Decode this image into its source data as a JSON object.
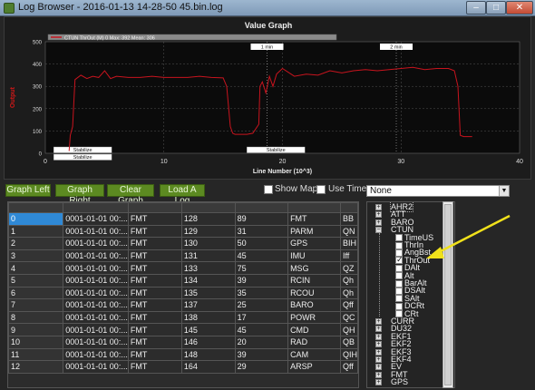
{
  "window": {
    "title": "Log Browser - 2016-01-13 14-28-50 45.bin.log",
    "minimize_glyph": "–",
    "maximize_glyph": "□",
    "close_glyph": "✕"
  },
  "graph": {
    "title": "Value Graph",
    "legend_text": "CTUN ThrOut (M) 0 Max: 392 Mean: 306",
    "markers": [
      "1 min",
      "2 min"
    ],
    "bottom_labels": [
      "Stabilize",
      "Stabilize",
      "Stabilize"
    ],
    "colors": {
      "line": "#c8141e",
      "axis_label": "#d01818",
      "grid": "#555555"
    }
  },
  "chart_data": {
    "type": "line",
    "title": "Value Graph",
    "xlabel": "Line Number (10^3)",
    "ylabel": "Output",
    "xlim": [
      0,
      40
    ],
    "ylim": [
      0,
      500
    ],
    "xticks": [
      "0",
      "10",
      "20",
      "30",
      "40"
    ],
    "yticks": [
      "0",
      "100",
      "200",
      "300",
      "400",
      "500"
    ],
    "series": [
      {
        "name": "CTUN ThrOut (M) 0 Max: 392 Mean: 306",
        "x": [
          2.0,
          2.1,
          2.3,
          2.5,
          3.0,
          3.5,
          4.0,
          4.5,
          5.0,
          5.5,
          6.0,
          7.0,
          8.0,
          9.0,
          10.0,
          11.0,
          12.0,
          13.0,
          14.0,
          15.0,
          15.3,
          15.6,
          15.8,
          16.0,
          16.5,
          17.0,
          17.5,
          18.0,
          18.1,
          18.3,
          18.6,
          18.9,
          19.2,
          19.5,
          20.0,
          21.0,
          22.0,
          23.0,
          24.0,
          25.0,
          26.0,
          27.0,
          28.0,
          29.0,
          30.0,
          31.0,
          32.0,
          33.0,
          34.0,
          34.5,
          34.8,
          35.0,
          35.3,
          36.0
        ],
        "y": [
          10,
          80,
          120,
          330,
          350,
          335,
          345,
          340,
          370,
          335,
          345,
          340,
          340,
          345,
          340,
          340,
          340,
          345,
          340,
          338,
          300,
          120,
          90,
          85,
          85,
          85,
          90,
          130,
          300,
          320,
          270,
          345,
          300,
          355,
          380,
          345,
          355,
          350,
          370,
          360,
          370,
          375,
          370,
          375,
          380,
          385,
          375,
          380,
          380,
          370,
          300,
          80,
          75,
          75
        ]
      }
    ],
    "grid": true,
    "legend": "top-left"
  },
  "toolbar": {
    "graph_left": "Graph Left",
    "graph_right": "Graph Right",
    "clear_graph": "Clear Graph",
    "load_a_log": "Load A Log",
    "show_map": "Show Map",
    "use_time": "Use Time",
    "select_value": "None"
  },
  "table": {
    "rows": [
      [
        "0",
        "0001-01-01 00:...",
        "FMT",
        "128",
        "89",
        "FMT",
        "BB"
      ],
      [
        "1",
        "0001-01-01 00:...",
        "FMT",
        "129",
        "31",
        "PARM",
        "QN"
      ],
      [
        "2",
        "0001-01-01 00:...",
        "FMT",
        "130",
        "50",
        "GPS",
        "BIH"
      ],
      [
        "3",
        "0001-01-01 00:...",
        "FMT",
        "131",
        "45",
        "IMU",
        "Iff"
      ],
      [
        "4",
        "0001-01-01 00:...",
        "FMT",
        "133",
        "75",
        "MSG",
        "QZ"
      ],
      [
        "5",
        "0001-01-01 00:...",
        "FMT",
        "134",
        "39",
        "RCIN",
        "Qh"
      ],
      [
        "6",
        "0001-01-01 00:...",
        "FMT",
        "135",
        "35",
        "RCOU",
        "Qh"
      ],
      [
        "7",
        "0001-01-01 00:...",
        "FMT",
        "137",
        "25",
        "BARO",
        "Qff"
      ],
      [
        "8",
        "0001-01-01 00:...",
        "FMT",
        "138",
        "17",
        "POWR",
        "QC"
      ],
      [
        "9",
        "0001-01-01 00:...",
        "FMT",
        "145",
        "45",
        "CMD",
        "QH"
      ],
      [
        "10",
        "0001-01-01 00:...",
        "FMT",
        "146",
        "20",
        "RAD",
        "QB"
      ],
      [
        "11",
        "0001-01-01 00:...",
        "FMT",
        "148",
        "39",
        "CAM",
        "QIH"
      ],
      [
        "12",
        "0001-01-01 00:...",
        "FMT",
        "164",
        "29",
        "ARSP",
        "Qff"
      ]
    ]
  },
  "tree": {
    "nodes": [
      {
        "label": "AHR2",
        "type": "group",
        "expanded": false
      },
      {
        "label": "ATT",
        "type": "group",
        "expanded": false
      },
      {
        "label": "BARO",
        "type": "group",
        "expanded": false
      },
      {
        "label": "CTUN",
        "type": "group",
        "expanded": true
      },
      {
        "label": "TimeUS",
        "type": "field",
        "checked": false
      },
      {
        "label": "ThrIn",
        "type": "field",
        "checked": false
      },
      {
        "label": "AngBst",
        "type": "field",
        "checked": false
      },
      {
        "label": "ThrOut",
        "type": "field",
        "checked": true
      },
      {
        "label": "DAlt",
        "type": "field",
        "checked": false
      },
      {
        "label": "Alt",
        "type": "field",
        "checked": false
      },
      {
        "label": "BarAlt",
        "type": "field",
        "checked": false
      },
      {
        "label": "DSAlt",
        "type": "field",
        "checked": false
      },
      {
        "label": "SAlt",
        "type": "field",
        "checked": false
      },
      {
        "label": "DCRt",
        "type": "field",
        "checked": false
      },
      {
        "label": "CRt",
        "type": "field",
        "checked": false
      },
      {
        "label": "CURR",
        "type": "group",
        "expanded": false
      },
      {
        "label": "DU32",
        "type": "group",
        "expanded": false
      },
      {
        "label": "EKF1",
        "type": "group",
        "expanded": false
      },
      {
        "label": "EKF2",
        "type": "group",
        "expanded": false
      },
      {
        "label": "EKF3",
        "type": "group",
        "expanded": false
      },
      {
        "label": "EKF4",
        "type": "group",
        "expanded": false
      },
      {
        "label": "EV",
        "type": "group",
        "expanded": false
      },
      {
        "label": "FMT",
        "type": "group",
        "expanded": false
      },
      {
        "label": "GPS",
        "type": "group",
        "expanded": false
      }
    ]
  },
  "annotation": {
    "color": "#f0e11b",
    "icon": "arrow-icon"
  }
}
